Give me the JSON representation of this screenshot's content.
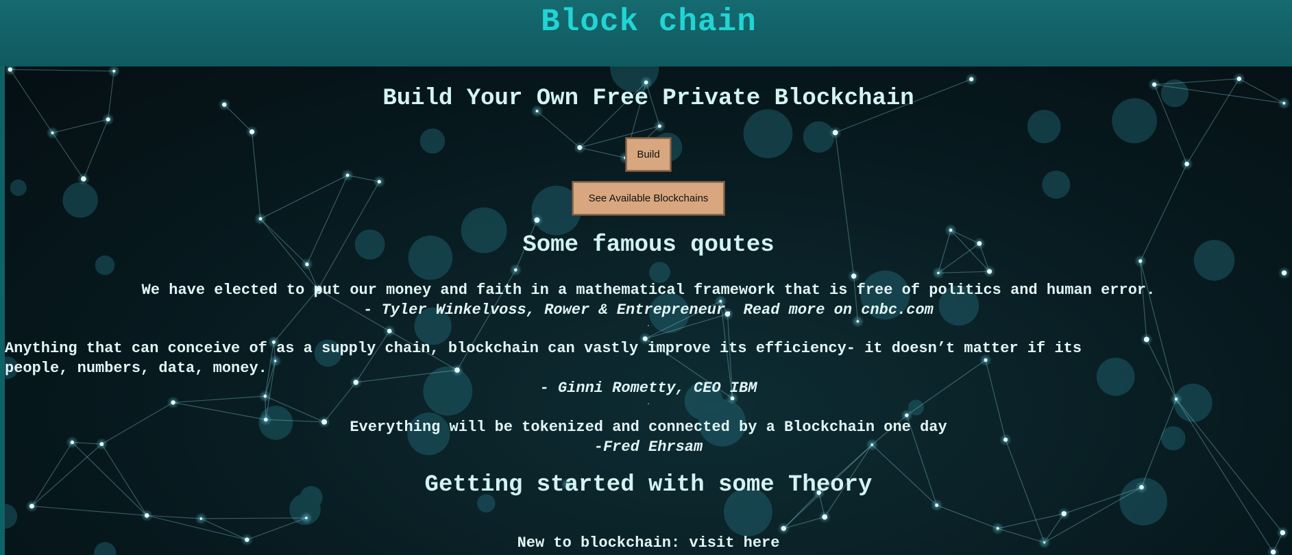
{
  "header": {
    "title": "Block chain"
  },
  "hero": {
    "heading": "Build Your Own Free Private Blockchain",
    "build_button": "Build",
    "see_button": "See Available Blockchains"
  },
  "quotes": {
    "heading": "Some famous qoutes",
    "items": [
      {
        "text": "We have elected to put our money and faith in a mathematical framework that is free of politics and human error.",
        "author": "- Tyler Winkelvoss, Rower & Entrepreneur, Read more on cnbc.com"
      },
      {
        "text_line1": "Anything that can conceive of as a supply chain, blockchain can vastly improve its efficiency- it doesn’t matter if its",
        "text_line2": "people, numbers, data, money.",
        "author": "- Ginni Rometty, CEO IBM"
      },
      {
        "text": "Everything will be tokenized and connected by a Blockchain one day",
        "author": "-Fred Ehrsam"
      }
    ],
    "separator": "."
  },
  "theory": {
    "heading": "Getting started with some Theory",
    "new_to": "New to blockchain: ",
    "visit_here": "visit here"
  },
  "colors": {
    "header_bg": "#156a70",
    "title_text": "#22d4d4",
    "button_bg": "#d9a77f",
    "content_text": "#d9f2f2"
  }
}
